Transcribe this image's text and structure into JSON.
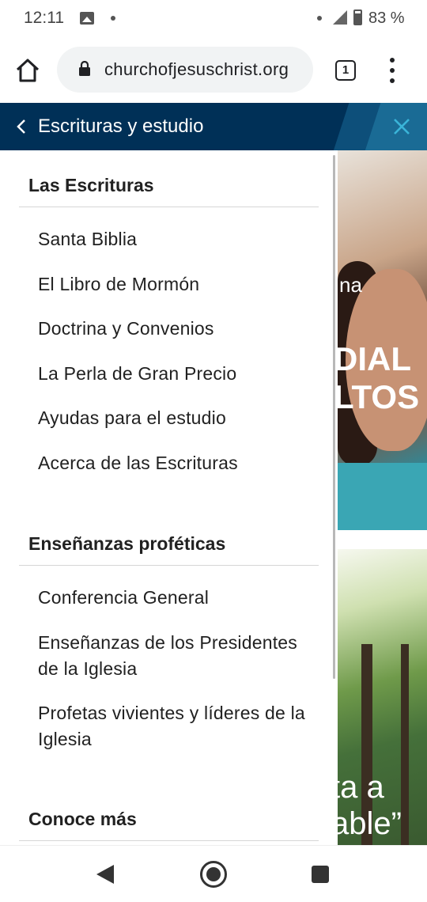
{
  "status_bar": {
    "time": "12:11",
    "battery": "83 %",
    "icons": [
      "image-icon",
      "notification-dot-icon",
      "wifi-dot-icon",
      "signal-icon",
      "battery-icon"
    ]
  },
  "browser": {
    "url": "churchofjesuschrist.org",
    "url_display": "churchofjesuschrist.org",
    "tab_count": "1",
    "icons": [
      "home-icon",
      "lock-icon",
      "tabs-icon",
      "overflow-menu-icon"
    ]
  },
  "nav_header": {
    "title": "Escrituras y estudio",
    "icons": [
      "back-chevron-icon",
      "close-icon"
    ],
    "colors": {
      "background": "#003057",
      "close": "#3ab4d8"
    }
  },
  "drawer": {
    "sections": [
      {
        "heading": "Las Escrituras",
        "links": [
          "Santa Biblia",
          "El Libro de Mormón",
          "Doctrina y Convenios",
          "La Perla de Gran Precio",
          "Ayudas para el estudio",
          "Acerca de las Escrituras"
        ]
      },
      {
        "heading": "Enseñanzas proféticas",
        "links": [
          "Conferencia General",
          "Enseñanzas de los Presidentes de la Iglesia",
          "Profetas vivientes y líderes de la Iglesia"
        ]
      },
      {
        "heading": "Conoce más",
        "links": []
      }
    ]
  },
  "background_page": {
    "hero_subtitle": "na",
    "hero_title": "DIAL\nLTOS",
    "forest_text": "ta a\nable”"
  },
  "system_nav": {
    "icons": [
      "nav-back-icon",
      "nav-home-icon",
      "nav-recents-icon"
    ]
  }
}
